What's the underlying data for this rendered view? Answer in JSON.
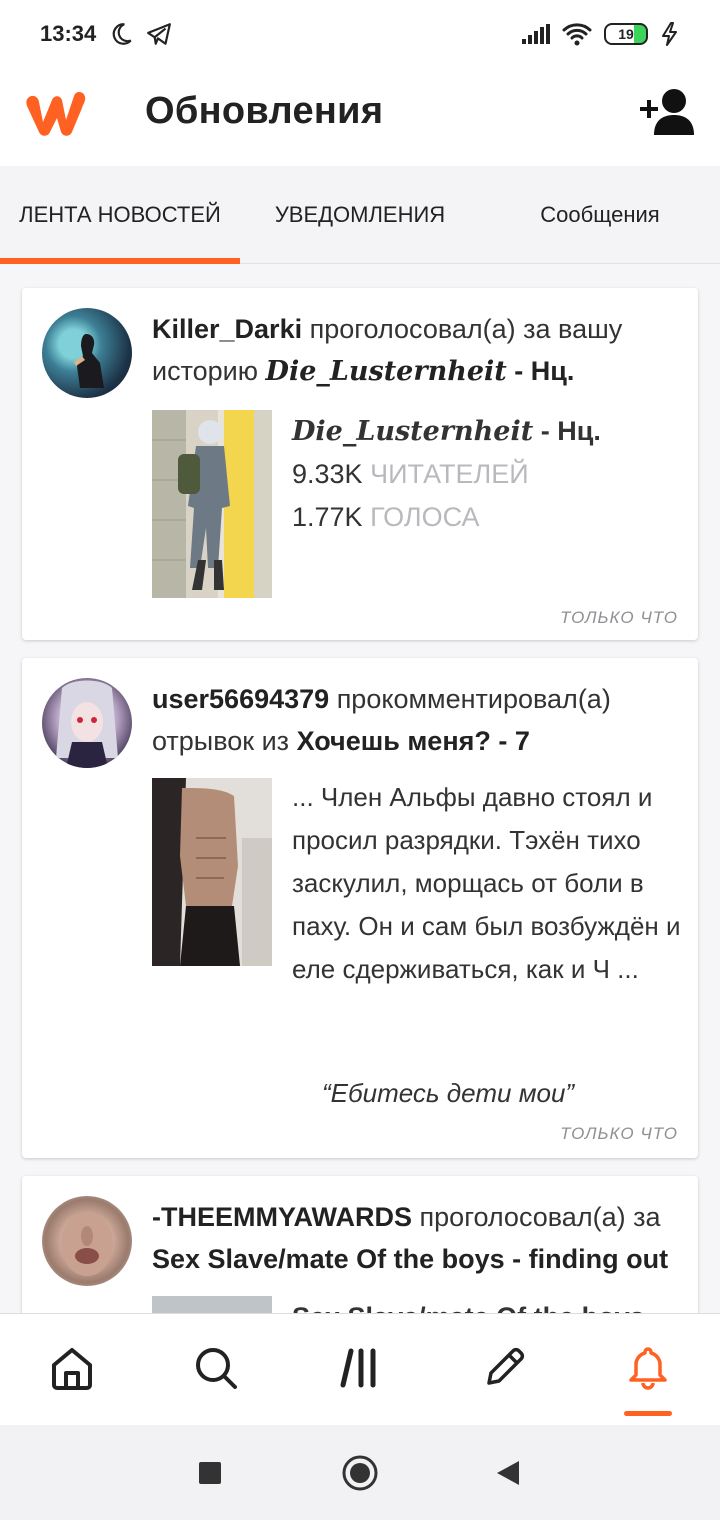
{
  "status_bar": {
    "time": "13:34",
    "battery": "19"
  },
  "header": {
    "title": "Обновления"
  },
  "tabs": [
    {
      "label": "ЛЕНТА НОВОСТЕЙ",
      "active": true
    },
    {
      "label": "УВЕДОМЛЕНИЯ",
      "active": false
    },
    {
      "label": "Сообщения",
      "active": false
    }
  ],
  "feed": [
    {
      "user": "Killer_Darki",
      "action": "проголосовал(а) за вашу историю",
      "story_title": "Die_Lusternheit",
      "story_suffix": "- Нц.",
      "reads_value": "9.33K",
      "reads_label": "ЧИТАТЕЛЕЙ",
      "votes_value": "1.77K",
      "votes_label": "ГОЛОСА",
      "time": "ТОЛЬКО ЧТО"
    },
    {
      "user": "user56694379",
      "action": "прокомментировал(а) отрывок из",
      "story_title": "Хочешь меня? - 7",
      "excerpt": "... Член Альфы давно стоял и просил разрядки. Тэхён тихо заскулил, морщась от боли в паху. Он и сам был возбуждён и еле сдерживаться, как и Ч ...",
      "comment": "“Ебитесь дети мои”",
      "time": "ТОЛЬКО ЧТО"
    },
    {
      "user": "-THEEMMYAWARDS",
      "action": "проголосовал(а) за",
      "story_title": "Sex Slave/mate Of the boys - finding out",
      "preview_title": "Sex Slave/mate Of the boys"
    }
  ],
  "colors": {
    "accent": "#ff6122",
    "muted_text": "#b9b9bd"
  },
  "icons": [
    "moon-icon",
    "telegram-icon",
    "signal-icon",
    "wifi-icon",
    "battery-icon",
    "charging-icon",
    "wattpad-logo",
    "add-friend-icon",
    "home-icon",
    "search-icon",
    "library-icon",
    "write-icon",
    "bell-icon",
    "recents-icon",
    "home-circle-icon",
    "back-icon"
  ]
}
